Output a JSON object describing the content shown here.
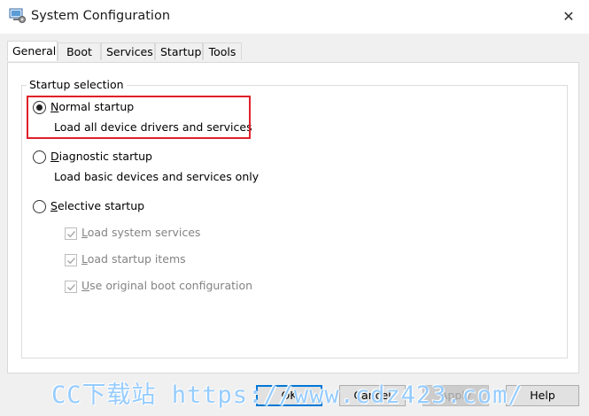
{
  "window": {
    "title": "System Configuration",
    "close_glyph": "✕"
  },
  "tabs": [
    {
      "label": "General",
      "active": true
    },
    {
      "label": "Boot",
      "active": false
    },
    {
      "label": "Services",
      "active": false
    },
    {
      "label": "Startup",
      "active": false
    },
    {
      "label": "Tools",
      "active": false
    }
  ],
  "startup_selection": {
    "group_title": "Startup selection",
    "normal": {
      "accel": "N",
      "rest": "ormal startup",
      "description": "Load all device drivers and services",
      "selected": true
    },
    "diagnostic": {
      "accel": "D",
      "rest": "iagnostic startup",
      "description": "Load basic devices and services only",
      "selected": false
    },
    "selective": {
      "accel": "S",
      "rest": "elective startup",
      "selected": false
    },
    "options": [
      {
        "accel": "L",
        "rest": "oad system services",
        "checked": true,
        "enabled": false
      },
      {
        "accel": "L",
        "rest": "oad startup items",
        "checked": true,
        "enabled": false
      },
      {
        "accel": "U",
        "rest": "se original boot configuration",
        "checked": true,
        "enabled": false
      }
    ]
  },
  "buttons": {
    "ok": "OK",
    "cancel": "Cancel",
    "apply": "Apply",
    "help": "Help"
  },
  "watermark": "CC下载站 https://www.cdz423.com/",
  "colors": {
    "highlight": "#e0202a",
    "accent": "#0078d7"
  }
}
